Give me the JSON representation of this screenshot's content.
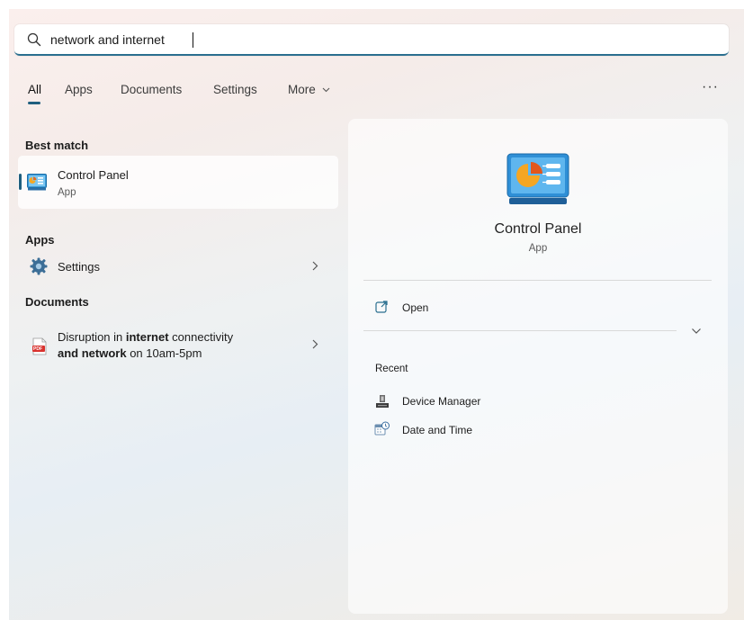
{
  "search": {
    "value": "network and internet",
    "icon": "search-icon"
  },
  "tabs": [
    {
      "label": "All",
      "active": true
    },
    {
      "label": "Apps"
    },
    {
      "label": "Documents"
    },
    {
      "label": "Settings"
    },
    {
      "label": "More"
    }
  ],
  "more_dots": "···",
  "left": {
    "best_match_heading": "Best match",
    "best_match": {
      "name": "Control Panel",
      "type": "App"
    },
    "apps_heading": "Apps",
    "apps": [
      {
        "name": "Settings"
      }
    ],
    "documents_heading": "Documents",
    "documents": [
      {
        "title_pre": "Disruption in ",
        "title_bold1": "internet",
        "title_mid": " connectivity",
        "title_bold2": "and network",
        "title_post": " on 10am-5pm",
        "badge": "PDF"
      }
    ]
  },
  "right": {
    "title": "Control Panel",
    "subtitle": "App",
    "open_label": "Open",
    "recent_heading": "Recent",
    "recent": [
      {
        "label": "Device Manager"
      },
      {
        "label": "Date and Time"
      }
    ]
  },
  "colors": {
    "accent": "#1f5f7f",
    "search_underline": "#2a6f8f"
  }
}
